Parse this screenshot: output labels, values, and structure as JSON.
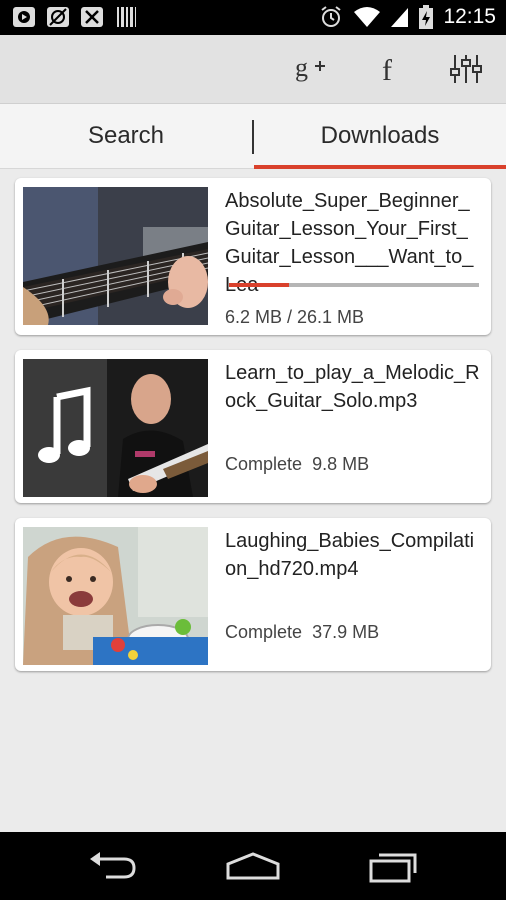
{
  "status_bar": {
    "left_icons": [
      "play-notification-icon",
      "no-sim-icon",
      "sd-card-error-icon",
      "barcode-icon"
    ],
    "right_icons": [
      "alarm-icon",
      "wifi-icon",
      "cell-signal-icon",
      "battery-charging-icon"
    ],
    "time": "12:15"
  },
  "action_bar": {
    "buttons": [
      {
        "name": "google-plus-button",
        "icon": "google-plus-icon",
        "glyph": "g+"
      },
      {
        "name": "facebook-button",
        "icon": "facebook-icon",
        "glyph": "f"
      },
      {
        "name": "settings-button",
        "icon": "sliders-icon"
      }
    ]
  },
  "tabs": [
    {
      "label": "Search",
      "selected": false
    },
    {
      "label": "Downloads",
      "selected": true
    }
  ],
  "accent_color": "#d9412c",
  "downloads": [
    {
      "title": "Absolute_Super_Beginner_Guitar_Lesson_Your_First_Guitar_Lesson___Want_to_Lea",
      "progress": 0.24,
      "status": "6.2 MB / 26.1 MB",
      "thumbnail": "guitar-lesson-thumbnail"
    },
    {
      "title": "Learn_to_play_a_Melodic_Rock_Guitar_Solo.mp3",
      "status": "Complete",
      "size": "9.8 MB",
      "thumbnail": "music-note-guitarist-thumbnail"
    },
    {
      "title": "Laughing_Babies_Compilation_hd720.mp4",
      "status": "Complete",
      "size": "37.9 MB",
      "thumbnail": "laughing-baby-thumbnail"
    }
  ],
  "nav_bar": {
    "buttons": [
      "back-icon",
      "home-icon",
      "recent-apps-icon"
    ]
  }
}
